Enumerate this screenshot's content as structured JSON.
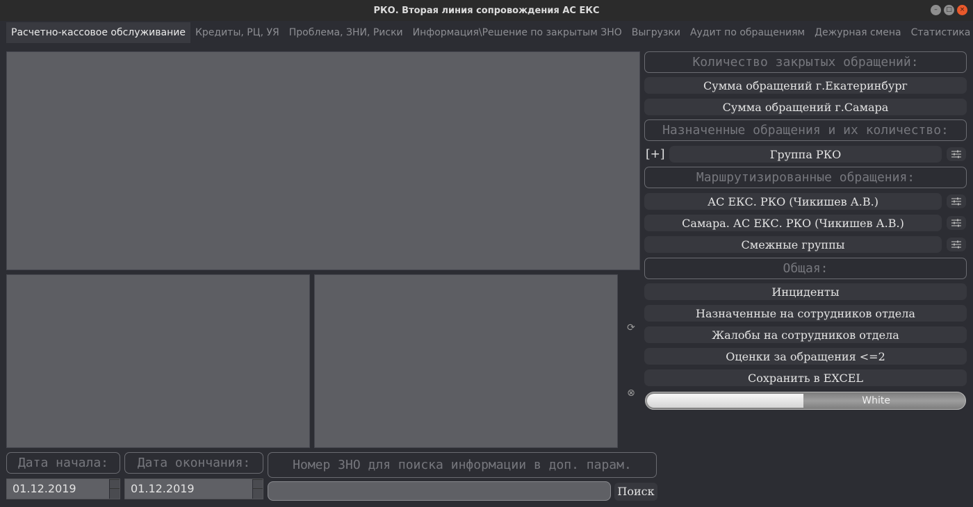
{
  "window": {
    "title": "РКО. Вторая линия сопровождения АС ЕКС",
    "controls": {
      "minimize": "–",
      "maximize": "□",
      "close": "×"
    }
  },
  "tabs": [
    {
      "label": "Расчетно-кассовое обслуживание",
      "active": true
    },
    {
      "label": "Кредиты, РЦ, УЯ"
    },
    {
      "label": "Проблема, ЗНИ, Риски"
    },
    {
      "label": "Информация\\Решение по закрытым ЗНО"
    },
    {
      "label": "Выгрузки"
    },
    {
      "label": "Аудит по обращениям"
    },
    {
      "label": "Дежурная смена"
    },
    {
      "label": "Статистика"
    }
  ],
  "side_icons": {
    "refresh": "⟳",
    "clear": "⊗"
  },
  "right": {
    "closed_header": "Количество закрытых обращений:",
    "sum_ekb": "Сумма обращений г.Екатеринбург",
    "sum_samara": "Сумма обращений г.Самара",
    "assigned_header": "Назначенные обращения и их количество:",
    "expand": "[+]",
    "group_rko": "Группа РКО",
    "routed_header": "Маршрутизированные обращения:",
    "as_eks_rko": "АС ЕКС. РКО (Чикишев А.В.)",
    "samara_as_eks_rko": "Самара. АС ЕКС. РКО (Чикишев А.В.)",
    "related_groups": "Смежные группы",
    "general_header": "Общая:",
    "incidents": "Инциденты",
    "assigned_staff": "Назначенные на сотрудников отдела",
    "complaints_staff": "Жалобы на сотрудников отдела",
    "ratings": "Оценки за обращения <=2",
    "save_excel": "Сохранить в EXCEL",
    "theme_slider": {
      "label": "White",
      "value": 0.49
    }
  },
  "bottom": {
    "start_date_label": "Дата начала:",
    "end_date_label": "Дата окончания:",
    "search_label": "Номер ЗНО для поиска информации в доп. парам.",
    "start_date": "01.12.2019",
    "end_date": "01.12.2019",
    "search_value": "",
    "search_button": "Поиск"
  }
}
